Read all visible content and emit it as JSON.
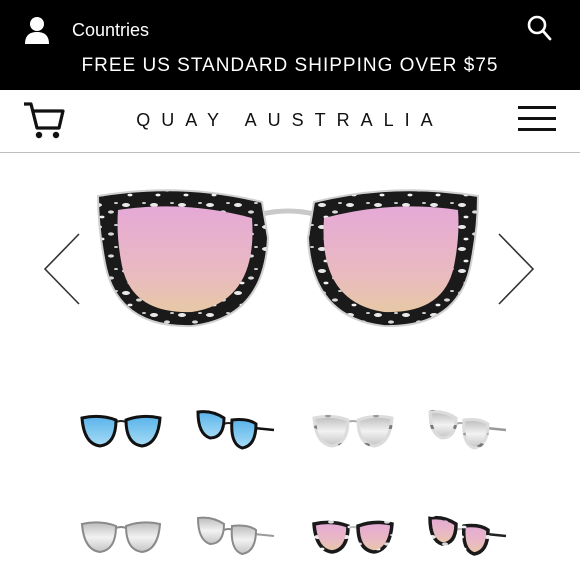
{
  "topbar": {
    "countries_label": "Countries",
    "shipping_text": "FREE US STANDARD SHIPPING OVER $75"
  },
  "header": {
    "brand": "QUAY AUSTRALIA"
  },
  "icons": {
    "user": "user-icon",
    "search": "search-icon",
    "cart": "cart-icon",
    "menu": "hamburger-menu-icon",
    "prev": "chevron-left-icon",
    "next": "chevron-right-icon"
  },
  "colors": {
    "topbar_bg": "#000000",
    "lens_pink": "#e3b3c3",
    "lens_blue": "#7fc6ee",
    "lens_silver": "#cfcfcf"
  },
  "gallery": {
    "main_variant": "black tortoise frame, pink mirror lens",
    "thumbnails": [
      {
        "variant": "black frame, blue mirror lens"
      },
      {
        "variant": "black frame, blue mirror lens (angled)"
      },
      {
        "variant": "clear/white tortoise frame, silver mirror lens"
      },
      {
        "variant": "clear/white tortoise frame, silver mirror lens (angled)"
      },
      {
        "variant": "silver frame, silver mirror lens"
      },
      {
        "variant": "silver frame, silver mirror lens (angled)"
      },
      {
        "variant": "black tortoise frame, pink mirror lens"
      },
      {
        "variant": "black tortoise frame, pink mirror lens (angled)"
      }
    ]
  }
}
